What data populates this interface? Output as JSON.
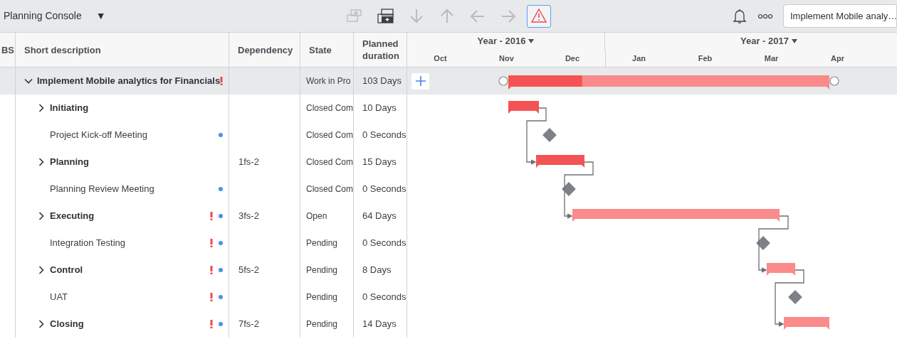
{
  "header": {
    "title": "Planning Console",
    "menu_glyph": "▼"
  },
  "toolbar": [
    {
      "kind": "add-above",
      "disabled": true,
      "selected": false
    },
    {
      "kind": "add-below",
      "disabled": false,
      "selected": false
    },
    {
      "kind": "down",
      "disabled": true,
      "selected": false
    },
    {
      "kind": "up",
      "disabled": true,
      "selected": false
    },
    {
      "kind": "left",
      "disabled": true,
      "selected": false
    },
    {
      "kind": "right",
      "disabled": true,
      "selected": false
    },
    {
      "kind": "warning",
      "disabled": false,
      "selected": true
    }
  ],
  "search": {
    "value": "Implement Mobile analy…"
  },
  "columns": [
    "BS",
    "Short description",
    "Dependency",
    "State",
    "Planned duration"
  ],
  "timeline": {
    "years": [
      "Year - 2016",
      "Year - 2017"
    ],
    "months": [
      "Oct",
      "Nov",
      "Dec",
      "Jan",
      "Feb",
      "Mar",
      "Apr"
    ]
  },
  "rows": [
    {
      "kind": "summary",
      "name": "Implement Mobile analytics for Financials",
      "expanded": true,
      "selected": true,
      "flagged": true,
      "noted": false,
      "state": "Work in Pro",
      "duration": "103 Days",
      "level": 0.23,
      "children": [
        {
          "kind": "group",
          "name": "Initiating",
          "expanded": false,
          "selected": false,
          "flagged": false,
          "noted": false,
          "state": "Closed Com",
          "duration": "10 Days",
          "level": 1
        },
        {
          "kind": "milestone",
          "name": "Project Kick-off Meeting",
          "selected": false,
          "flagged": false,
          "noted": true,
          "state": "Closed Com",
          "duration": "0 Seconds"
        },
        {
          "kind": "group",
          "name": "Planning",
          "expanded": false,
          "selected": false,
          "flagged": false,
          "noted": false,
          "dependency": "1fs-2",
          "state": "Closed Com",
          "duration": "15 Days",
          "level": 1
        },
        {
          "kind": "milestone",
          "name": "Planning Review Meeting",
          "selected": false,
          "flagged": false,
          "noted": true,
          "state": "Closed Com",
          "duration": "0 Seconds"
        },
        {
          "kind": "group",
          "name": "Executing",
          "expanded": false,
          "selected": false,
          "flagged": true,
          "noted": true,
          "dependency": "3fs-2",
          "state": "Open",
          "duration": "64 Days",
          "level": 0
        },
        {
          "kind": "milestone",
          "name": "Integration Testing",
          "selected": false,
          "flagged": true,
          "noted": true,
          "state": "Pending",
          "duration": "0 Seconds"
        },
        {
          "kind": "group",
          "name": "Control",
          "expanded": false,
          "selected": false,
          "flagged": true,
          "noted": true,
          "dependency": "5fs-2",
          "state": "Pending",
          "duration": "8 Days",
          "level": 0
        },
        {
          "kind": "milestone",
          "name": "UAT",
          "selected": false,
          "flagged": true,
          "noted": true,
          "state": "Pending",
          "duration": "0 Seconds"
        },
        {
          "kind": "group",
          "name": "Closing",
          "expanded": false,
          "selected": false,
          "flagged": true,
          "noted": true,
          "dependency": "7fs-2",
          "state": "Pending",
          "duration": "14 Days",
          "level": 0
        }
      ]
    }
  ]
}
